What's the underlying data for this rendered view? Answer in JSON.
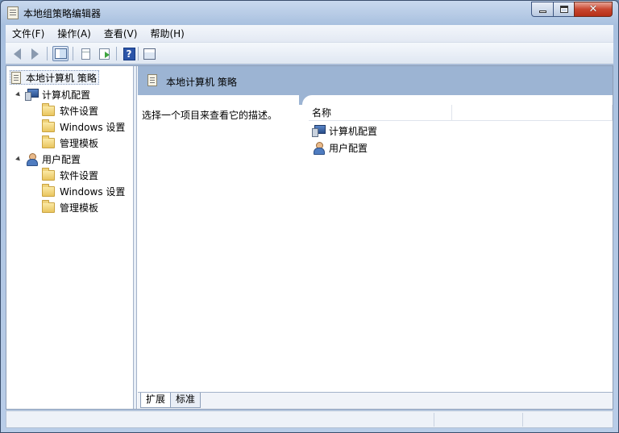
{
  "window": {
    "title": "本地组策略编辑器",
    "controls": {
      "minimize": "",
      "maximize": "",
      "close": "✕"
    }
  },
  "menu": [
    "文件(F)",
    "操作(A)",
    "查看(V)",
    "帮助(H)"
  ],
  "toolbar": {
    "icons": [
      "back-icon",
      "forward-icon",
      "show-tree-icon",
      "properties-doc-icon",
      "export-list-icon",
      "help-icon",
      "view-icon"
    ],
    "help_glyph": "?"
  },
  "tree": {
    "root": "本地计算机 策略",
    "computer_config": {
      "label": "计算机配置",
      "children": [
        "软件设置",
        "Windows 设置",
        "管理模板"
      ]
    },
    "user_config": {
      "label": "用户配置",
      "children": [
        "软件设置",
        "Windows 设置",
        "管理模板"
      ]
    }
  },
  "details": {
    "header_title": "本地计算机 策略",
    "description": "选择一个项目来查看它的描述。",
    "column_name": "名称",
    "items": [
      "计算机配置",
      "用户配置"
    ]
  },
  "tabs": [
    "扩展",
    "标准"
  ],
  "colors": {
    "header_blue": "#9cb4d3",
    "title_bg": "#b9cde8",
    "close_red": "#c8462f"
  }
}
